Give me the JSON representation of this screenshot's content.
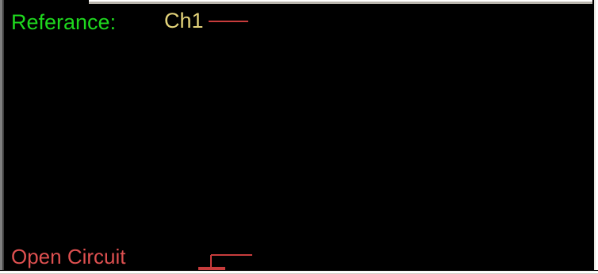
{
  "reference": {
    "label": "Referance:",
    "channel": "Ch1"
  },
  "status": {
    "label": "Open Circuit"
  },
  "colors": {
    "screen_background": "#000000",
    "reference_label": "#1ed81e",
    "channel_label": "#e3d37a",
    "trace_line": "#c83c3c",
    "status_label": "#de5050"
  },
  "icons": {
    "channel_marker": "horizontal-line-icon",
    "open_circuit_marker": "open-circuit-symbol-icon"
  }
}
